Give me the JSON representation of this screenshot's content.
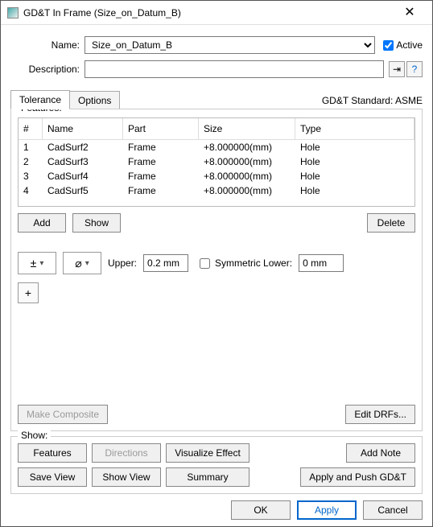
{
  "titlebar": {
    "title": "GD&T In Frame (Size_on_Datum_B)"
  },
  "form": {
    "name_label": "Name:",
    "name_value": "Size_on_Datum_B",
    "active_label": "Active",
    "desc_label": "Description:",
    "desc_value": ""
  },
  "tabs": {
    "tolerance": "Tolerance",
    "options": "Options"
  },
  "standard": "GD&T Standard: ASME",
  "features": {
    "legend": "Features:",
    "headers": {
      "num": "#",
      "name": "Name",
      "part": "Part",
      "size": "Size",
      "type": "Type"
    },
    "rows": [
      {
        "num": "1",
        "name": "CadSurf2",
        "part": "Frame",
        "size": "+8.000000(mm)",
        "type": "Hole"
      },
      {
        "num": "2",
        "name": "CadSurf3",
        "part": "Frame",
        "size": "+8.000000(mm)",
        "type": "Hole"
      },
      {
        "num": "3",
        "name": "CadSurf4",
        "part": "Frame",
        "size": "+8.000000(mm)",
        "type": "Hole"
      },
      {
        "num": "4",
        "name": "CadSurf5",
        "part": "Frame",
        "size": "+8.000000(mm)",
        "type": "Hole"
      }
    ],
    "add": "Add",
    "show": "Show",
    "delete": "Delete"
  },
  "tolerance": {
    "symbol1": "±",
    "symbol2": "⌀",
    "upper_label": "Upper:",
    "upper_value": "0.2 mm",
    "sym_label": "Symmetric Lower:",
    "lower_value": "0 mm",
    "plus": "+"
  },
  "buttons": {
    "make_composite": "Make Composite",
    "edit_drfs": "Edit DRFs..."
  },
  "show": {
    "legend": "Show:",
    "features": "Features",
    "directions": "Directions",
    "visualize": "Visualize Effect",
    "add_note": "Add Note",
    "save_view": "Save View",
    "show_view": "Show View",
    "summary": "Summary",
    "apply_push": "Apply and Push GD&T"
  },
  "footer": {
    "ok": "OK",
    "apply": "Apply",
    "cancel": "Cancel"
  }
}
